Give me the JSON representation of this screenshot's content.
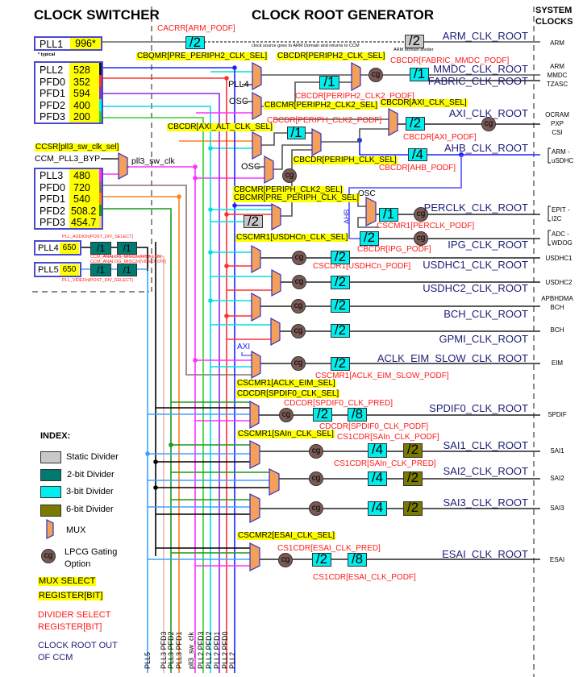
{
  "headers": {
    "switcher": "CLOCK SWITCHER",
    "generator": "CLOCK ROOT GENERATOR",
    "system_1": "SYSTEM",
    "system_2": "CLOCKS"
  },
  "sources": {
    "pll1": {
      "name": "PLL1",
      "value": "996*",
      "note": "* typical"
    },
    "pll2": [
      {
        "name": "PLL2",
        "value": "528"
      },
      {
        "name": "PFD0",
        "value": "352"
      },
      {
        "name": "PFD1",
        "value": "594"
      },
      {
        "name": "PFD2",
        "value": "400"
      },
      {
        "name": "PFD3",
        "value": "200"
      }
    ],
    "pll3_sel": "CCSR[pll3_sw_clk_sel]",
    "pll3_byp": "CCM_PLL3_BYP",
    "pll3_sw_clk": "pll3_sw_clk",
    "pll3": [
      {
        "name": "PLL3",
        "value": "480"
      },
      {
        "name": "PFD0",
        "value": "720"
      },
      {
        "name": "PFD1",
        "value": "540"
      },
      {
        "name": "PFD2",
        "value": "508.2"
      },
      {
        "name": "PFD3",
        "value": "454.7"
      }
    ],
    "pll4": {
      "name": "PLL4",
      "value": "650",
      "reg_top": "PLL_AUDIOn[POST_DIV_SELECT]",
      "reg_bottom": "CCM_ANALOG_MISC2n[MSB:LSB]"
    },
    "pll5": {
      "name": "PLL5",
      "value": "650",
      "reg_top": "CCM_ANALOG_MISC2n[VIDEO_DIV]",
      "reg_bottom": "PLL_VIDEOn[POST_DIV_SELECT]"
    }
  },
  "mux_regs": {
    "pre_periph2": "CBQMR[PRE_PERIPH2_CLK_SEL]",
    "periph2": "CBCDR[PERIPH2_CLK_SEL]",
    "periph2_clk2": "CBCMR[PERIPH2_CLK2_SEL]",
    "axi_alt": "CBCDR[AXI_ALT_CLK_SEL]",
    "axi": "CBCDR[AXI_CLK_SEL]",
    "periph": "CBCDR[PERIPH_CLK_SEL]",
    "periph_clk2": "CBCMR[PERIPH_CLK2_SEL]",
    "pre_periph": "CBCMR[PRE_PERIPH_CLK_SEL]",
    "usdhc": "CSCMR1[USDHCn_CLK_SEL]",
    "eim": "CSCMR1[ACLK_EIM_SEL]",
    "spdif": "CDCDR[SPDIF0_CLK_SEL]",
    "sai": "CSCMR1[SAIn_CLK_SEL]",
    "esai": "CSCMR2[ESAI_CLK_SEL]"
  },
  "div_regs": {
    "arm": "CACRR[ARM_PODF]",
    "fabric_mmdc": "CBCDR[FABRIC_MMDC_PODF]",
    "periph2_clk2": "CBCDR[PERIPH2_CLK2_PODF]",
    "periph_clk2": "CBCDR[PERIPH_CLK2_PODF]",
    "axi": "CBCDR[AXI_PODF]",
    "ahb": "CBCDR[AHB_PODF]",
    "perclk": "CSCMR1[PERCLK_PODF]",
    "ipg": "CBCDR[IPG_PODF]",
    "usdhc": "CSCDR1[USDHCn_PODF]",
    "eim": "CSCMR1[ACLK_EIM_SLOW_PODF]",
    "spdif_pred": "CDCDR[SPDIF0_CLK_PRED]",
    "spdif_podf": "CDCDR[SPDIF0_CLK_PODF]",
    "sai_podf": "CS1CDR[SAIn_CLK_PODF]",
    "sai_pred": "CS1CDR[SAIn_CLK_PRED]",
    "esai_pred": "CS1CDR[ESAI_CLK_PRED]",
    "esai_podf": "CS1CDR[ESAI_CLK_PODF]"
  },
  "dividers": {
    "arm_podf": "/2",
    "arm_domain": "/2",
    "periph2_clk2": "/1",
    "fabric_mmdc": "/1",
    "periph_clk2": "/1",
    "axi": "/2",
    "ahb": "/4",
    "pre_periph_static": "/2",
    "perclk": "/1",
    "ipg": "/2",
    "usdhc1": "/2",
    "usdhc2": "/2",
    "bch": "/2",
    "gpmi": "/2",
    "eim": "/2",
    "spdif_pred": "/2",
    "spdif_podf": "/8",
    "sai1_pred": "/4",
    "sai1_podf": "/2",
    "sai2_pred": "/4",
    "sai2_podf": "/2",
    "sai3_pred": "/4",
    "sai3_podf": "/2",
    "esai_pred": "/2",
    "esai_podf": "/8",
    "pll4_a": "/1",
    "pll4_b": "/1",
    "pll5_a": "/1",
    "pll5_b": "/1"
  },
  "cg_label": "cg",
  "notes": {
    "arm_path": "clock source goes to ARM Domain and returns to CCM",
    "arm_divider": "ARM domain divider"
  },
  "inputs": {
    "pll4": "PLL4",
    "osc": "OSC",
    "axi": "AXI",
    "ahb": "AHB"
  },
  "roots": {
    "arm": "ARM_CLK_ROOT",
    "mmdc": "MMDC_CLK_ROOT",
    "fabric": "FABRIC_CLK_ROOT",
    "axi": "AXI_CLK_ROOT",
    "ahb": "AHB_CLK_ROOT",
    "perclk": "PERCLK_CLK_ROOT",
    "ipg": "IPG_CLK_ROOT",
    "usdhc1": "USDHC1_CLK_ROOT",
    "usdhc2": "USDHC2_CLK_ROOT",
    "bch": "BCH_CLK_ROOT",
    "gpmi": "GPMI_CLK_ROOT",
    "eim": "ACLK_EIM_SLOW_CLK_ROOT",
    "spdif": "SPDIF0_CLK_ROOT",
    "sai1": "SAI1_CLK_ROOT",
    "sai2": "SAI2_CLK_ROOT",
    "sai3": "SAI3_CLK_ROOT",
    "esai": "ESAI_CLK_ROOT"
  },
  "system_clocks": {
    "arm": "ARM",
    "mmdc_1": "ARM",
    "mmdc_2": "MMDC",
    "mmdc_3": "TZASC",
    "axi_1": "OCRAM",
    "axi_2": "PXP",
    "axi_3": "CSI",
    "ahb_1": "ARM -",
    "ahb_2": "uSDHC",
    "per_1": "EPIT -",
    "per_2": "I2C",
    "ipg_1": "ADC -",
    "ipg_2": "WDOG",
    "usdhc1": "USDHC1",
    "usdhc2": "USDHC2",
    "bch_1": "APBHDMA",
    "bch_2": "BCH",
    "gpmi": "BCH",
    "eim": "EIM",
    "spdif": "SPDIF",
    "sai1": "SAI1",
    "sai2": "SAI2",
    "sai3": "SAI3",
    "esai": "ESAI"
  },
  "bus_labels": [
    "PLL5",
    "PLL3 PFD3",
    "PLL3 PFD2",
    "PLL3 PFD1",
    "pll3_sw_clk",
    "PLL2 PFD3",
    "PLL2 PFD2",
    "PLL2 PFD1",
    "PLL2 PFD0",
    "PLL2"
  ],
  "legend": {
    "title": "INDEX:",
    "static": "Static Divider",
    "two_bit": "2-bit Divider",
    "three_bit": "3-bit Divider",
    "six_bit": "6-bit Divider",
    "mux": "MUX",
    "lpcg_1": "LPCG Gating",
    "lpcg_2": "Option",
    "mux_sel_1": "MUX SELECT",
    "mux_sel_2": "REGISTER[BIT]",
    "div_sel_1": "DIVIDER SELECT",
    "div_sel_2": "REGISTER[BIT]",
    "root_1": "CLOCK ROOT OUT",
    "root_2": "OF CCM"
  },
  "colors": {
    "mux": "#f5a05a",
    "three_bit": "#00eeee",
    "two_bit": "#007a70",
    "six_bit": "#7a7a00",
    "static": "#c8c8c8",
    "cg": "#7a5a55",
    "pll2": "#2020ff",
    "pll2_pfd0": "#ff3030",
    "pll2_pfd1": "#8a2be2",
    "pll2_pfd2": "#00f0f0",
    "pll2_pfd3": "#30d030",
    "pll3_sw_clk": "#ff30ff",
    "pll3_pfd0": "#8a7070",
    "pll3_pfd1": "#ff8020",
    "pll3_pfd2": "#1a9a1a",
    "pll3_pfd3": "#e8b8b8",
    "pll5": "#40a0ff"
  }
}
